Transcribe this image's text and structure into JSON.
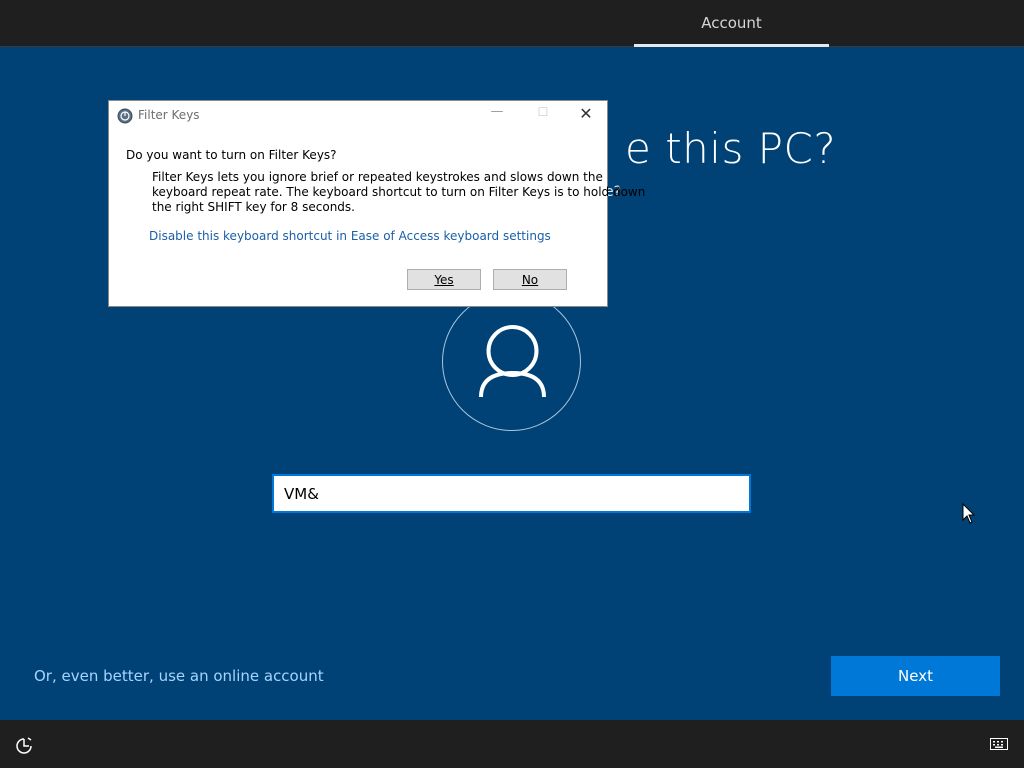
{
  "top": {
    "tab_label": "Account"
  },
  "main": {
    "heading": "e this PC?",
    "subheading": "e?",
    "name_value": "VM&",
    "online_link": "Or, even better, use an online account",
    "next_label": "Next"
  },
  "dialog": {
    "title": "Filter Keys",
    "question": "Do you want to turn on Filter Keys?",
    "body_lines": [
      "Filter Keys lets you ignore brief or repeated keystrokes and slows down the",
      "keyboard repeat rate.  The keyboard shortcut to turn on Filter Keys is to hold down",
      "the right SHIFT key for 8 seconds."
    ],
    "link": "Disable this keyboard shortcut in Ease of Access keyboard settings",
    "yes_label": "Yes",
    "no_label": "No"
  },
  "icons": {
    "dialog_app": "ease-of-access-icon",
    "avatar": "user-icon",
    "bottom_left": "ease-of-access-icon",
    "bottom_right": "keyboard-icon",
    "pointer": "mouse-cursor-icon"
  },
  "colors": {
    "background": "#004275",
    "accent": "#0078d7",
    "link": "#a5d4ff",
    "bars": "#1f1f1f"
  }
}
